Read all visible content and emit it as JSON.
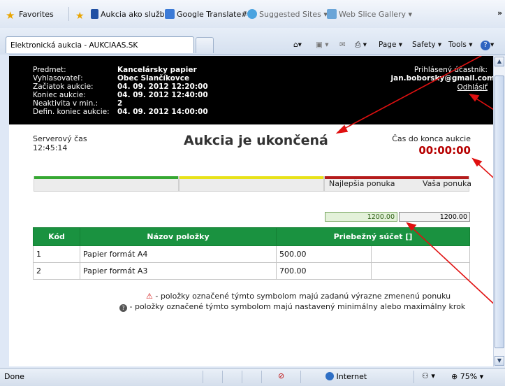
{
  "favorites_bar": {
    "favorites_label": "Favorites",
    "items": [
      "Aukcia ako služba",
      "Google Translate#",
      "Suggested Sites ▾",
      "Web Slice Gallery ▾"
    ],
    "more": "»"
  },
  "tab": {
    "title": "Elektronická aukcia - AUKCIAAS.SK"
  },
  "command_bar": {
    "page": "Page ▾",
    "safety": "Safety ▾",
    "tools": "Tools ▾"
  },
  "auction_header": {
    "labels": [
      "Predmet:",
      "Vyhlasovateľ:",
      "Začiatok aukcie:",
      "Koniec aukcie:",
      "Neaktivita v min.:",
      "Defin. koniec aukcie:"
    ],
    "values": [
      "Kancelársky papier",
      "Obec Slančíkovce",
      "04. 09. 2012 12:20:00",
      "04. 09. 2012 12:40:00",
      "2",
      "04. 09. 2012 14:00:00"
    ],
    "logged_in_label": "Prihlásený účastník:",
    "user": "jan.boborsky@gmail.com",
    "logout": "Odhlásiť"
  },
  "server_time": {
    "label": "Serverový čas",
    "value": "12:45:14"
  },
  "status_title": "Aukcia je ukončená",
  "countdown": {
    "label": "Čas do konca aukcie",
    "value": "00:00:00"
  },
  "progress_colors": [
    "#36a832",
    "#e8e21a",
    "#b51c1c"
  ],
  "offers": {
    "best_label": "Najlepšia ponuka",
    "your_label": "Vaša ponuka",
    "best_value": "1200.00",
    "your_value": "1200.00"
  },
  "table": {
    "headers": [
      "Kód",
      "Názov položky",
      "Priebežný súčet []"
    ],
    "rows": [
      {
        "code": "1",
        "name": "Papier formát A4",
        "sum": "500.00"
      },
      {
        "code": "2",
        "name": "Papier formát A3",
        "sum": "700.00"
      }
    ]
  },
  "legend": {
    "changed": "- položky označené týmto symbolom majú zadanú výrazne zmenenú ponuku",
    "step": "- položky označené týmto symbolom majú nastavený minimálny alebo maximálny krok"
  },
  "statusbar": {
    "left": "Done",
    "zone": "Internet",
    "zoom": "75%"
  }
}
